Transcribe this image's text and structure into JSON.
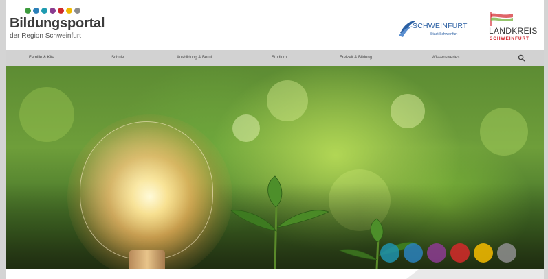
{
  "header": {
    "title": "Bildungsportal",
    "subtitle": "der Region Schweinfurt",
    "dot_colors": [
      "#3d9b3d",
      "#2a7fb8",
      "#1e9bb0",
      "#8a3b8f",
      "#cf2a2a",
      "#f0b800",
      "#8c8c8c"
    ],
    "partner_logos": [
      {
        "name": "SCHWEINFURT",
        "tagline": "Stadt Schweinfurt",
        "icon": "schweinfurt-swoosh-icon"
      },
      {
        "name": "LANDKREIS",
        "tagline": "SCHWEINFURT",
        "icon": "landkreis-flag-icon"
      }
    ]
  },
  "nav": {
    "items": [
      {
        "label": "Familie & Kita"
      },
      {
        "label": "Schule"
      },
      {
        "label": "Ausbildung & Beruf"
      },
      {
        "label": "Studium"
      },
      {
        "label": "Freizeit & Bildung"
      },
      {
        "label": "Wissenswertes"
      }
    ],
    "search_icon": "search-icon"
  },
  "hero": {
    "image": "light-bulb-with-green-seedlings",
    "color_dots": [
      "#1f8fa8",
      "#2a7fb8",
      "#8a3b8f",
      "#cf2a2a",
      "#f0b800",
      "#8c8c8c"
    ]
  },
  "colors": {
    "nav_background": "#d2d2d2",
    "title_color": "#3b3b3b",
    "brand_blue": "#2a5fa3",
    "brand_red": "#d2232a"
  }
}
